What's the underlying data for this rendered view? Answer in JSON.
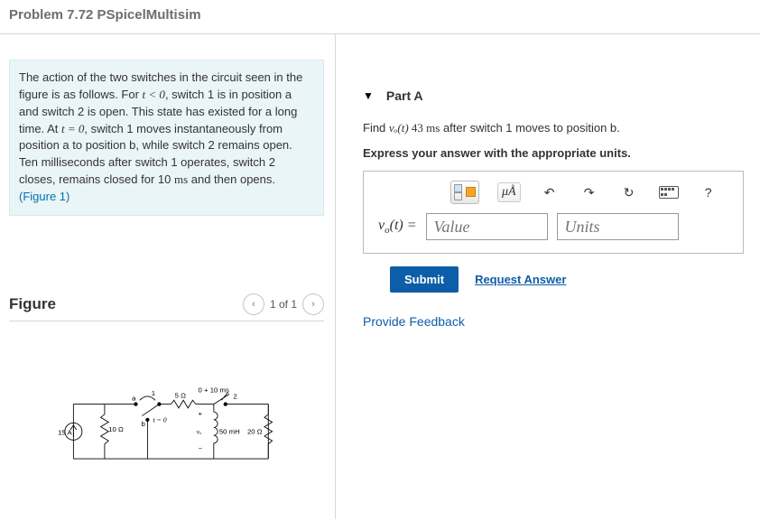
{
  "header": {
    "title": "Problem 7.72 PSpicelMultisim"
  },
  "description": {
    "text_before": "The action of the two switches in the circuit seen in the figure is as follows. For ",
    "cond1": "t < 0",
    "text_mid1": ", switch 1 is in position a and switch 2 is open. This state has existed for a long time. At ",
    "cond2": "t = 0",
    "text_mid2": ", switch 1 moves instantaneously from position a to position b, while switch 2 remains open. Ten milliseconds after switch 1 operates, switch 2 closes, remains closed for 10 ",
    "unit_ms": "ms",
    "text_end": " and then opens. ",
    "figlink": "(Figure 1)"
  },
  "figure": {
    "title": "Figure",
    "counter": "1 of 1",
    "labels": {
      "src": "15 A",
      "r1": "10 Ω",
      "r2": "5 Ω",
      "r3": "20 Ω",
      "L": "50 mH",
      "sw_a": "a",
      "sw_b": "b",
      "sw1": "1",
      "t0": "t = 0",
      "t10": "0 + 10 ms",
      "sw2": "2",
      "vo": "vₒ",
      "plus": "+",
      "minus": "−"
    }
  },
  "partA": {
    "label": "Part A",
    "question_pre": "Find ",
    "q_var": "vₒ(t)",
    "q_time": "  43 ms",
    "question_post": " after switch 1 moves to position b.",
    "instruct": "Express your answer with the appropriate units.",
    "toolbar": {
      "mu": "μÅ",
      "undo": "↶",
      "redo": "↷",
      "reset": "↻",
      "help": "?"
    },
    "answer_label": "vₒ(t) = ",
    "value_ph": "Value",
    "units_ph": "Units",
    "submit": "Submit",
    "request": "Request Answer"
  },
  "feedback": "Provide Feedback"
}
